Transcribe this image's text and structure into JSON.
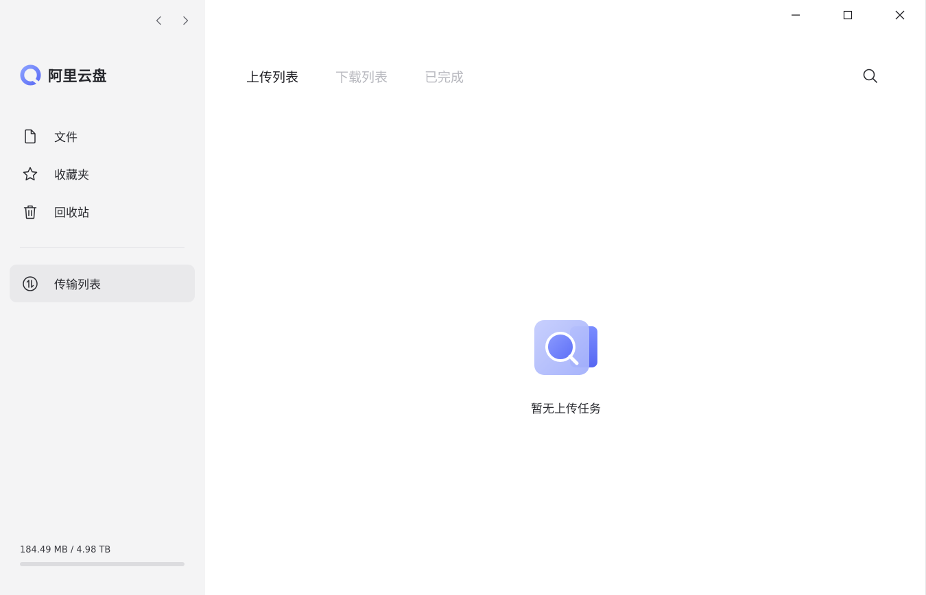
{
  "app": {
    "brand_name": "阿里云盘"
  },
  "sidebar": {
    "items": [
      {
        "label": "文件",
        "icon": "file-icon"
      },
      {
        "label": "收藏夹",
        "icon": "star-icon"
      },
      {
        "label": "回收站",
        "icon": "trash-icon"
      }
    ],
    "transfer": {
      "label": "传输列表",
      "icon": "transfer-icon"
    },
    "storage": {
      "text": "184.49 MB / 4.98 TB",
      "used_fraction": 4e-05
    }
  },
  "main": {
    "tabs": [
      {
        "label": "上传列表",
        "active": true
      },
      {
        "label": "下载列表",
        "active": false
      },
      {
        "label": "已完成",
        "active": false
      }
    ],
    "empty_text": "暂无上传任务"
  },
  "colors": {
    "accent": "#6b7cff",
    "sidebar_bg": "#f4f4f5",
    "active_item_bg": "#e9e9eb"
  }
}
